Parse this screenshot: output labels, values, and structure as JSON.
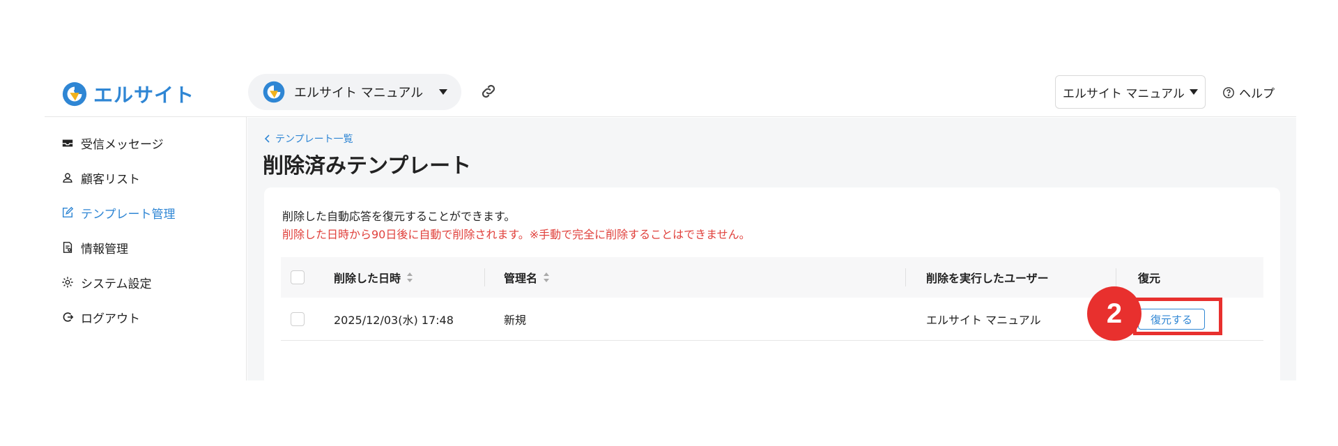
{
  "header": {
    "brand_name": "エルサイト",
    "account_name": "エルサイト マニュアル",
    "workspace_select_value": "エルサイト マニュアル",
    "help_label": "ヘルプ"
  },
  "sidebar": {
    "items": [
      {
        "label": "受信メッセージ",
        "icon": "inbox-icon"
      },
      {
        "label": "顧客リスト",
        "icon": "user-icon"
      },
      {
        "label": "テンプレート管理",
        "icon": "edit-icon",
        "active": true
      },
      {
        "label": "情報管理",
        "icon": "document-icon"
      },
      {
        "label": "システム設定",
        "icon": "gear-icon"
      },
      {
        "label": "ログアウト",
        "icon": "logout-icon"
      }
    ]
  },
  "main": {
    "breadcrumb": "テンプレート一覧",
    "title": "削除済みテンプレート",
    "description": "削除した自動応答を復元することができます。",
    "warning": "削除した日時から90日後に自動で削除されます。※手動で完全に削除することはできません。",
    "table": {
      "headers": {
        "deleted_at": "削除した日時",
        "name": "管理名",
        "user": "削除を実行したユーザー",
        "restore": "復元"
      },
      "rows": [
        {
          "deleted_at": "2025/12/03(水) 17:48",
          "name": "新規",
          "user": "エルサイト マニュアル",
          "restore_label": "復元する"
        }
      ]
    }
  },
  "annotation": {
    "step": "2"
  },
  "colors": {
    "accent": "#2f86d4",
    "warning": "#e0413c",
    "annotation": "#e8302e"
  }
}
